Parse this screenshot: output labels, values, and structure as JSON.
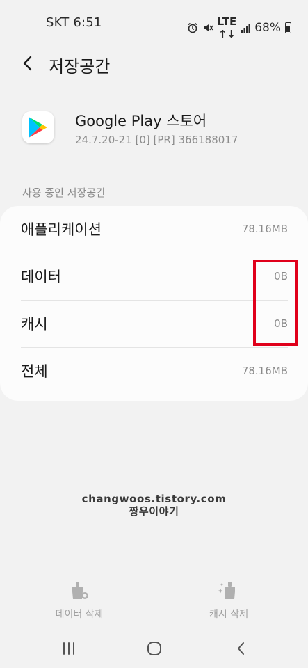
{
  "status_bar": {
    "carrier_time": "SKT 6:51",
    "lte_top": "LTE",
    "lte_bottom": "↑↓",
    "battery": "68%",
    "icons": [
      "alarm-icon",
      "mute-icon",
      "lte-icon",
      "signal-icon",
      "battery-icon"
    ]
  },
  "header": {
    "title": "저장공간"
  },
  "app": {
    "name": "Google Play 스토어",
    "version": "24.7.20-21 [0] [PR] 366188017",
    "icon": "google-play-icon"
  },
  "section": {
    "label": "사용 중인 저장공간"
  },
  "storage": {
    "rows": [
      {
        "label": "애플리케이션",
        "value": "78.16MB"
      },
      {
        "label": "데이터",
        "value": "0B"
      },
      {
        "label": "캐시",
        "value": "0B"
      },
      {
        "label": "전체",
        "value": "78.16MB"
      }
    ]
  },
  "watermark": {
    "line1": "changwoos.tistory.com",
    "line2": "짱우이야기"
  },
  "actions": {
    "clear_data": "데이터 삭제",
    "clear_cache": "캐시 삭제"
  },
  "colors": {
    "background": "#f2f2f2",
    "card": "#fcfcfc",
    "highlight": "#e0001b",
    "muted_text": "#8a8a8a"
  }
}
